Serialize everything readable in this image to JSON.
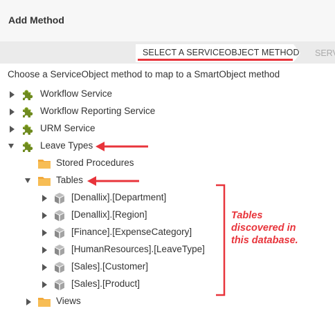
{
  "dialog": {
    "title": "Add Method"
  },
  "wizard": {
    "steps": [
      {
        "label": "SELECT A SERVICEOBJECT METHOD",
        "active": true
      },
      {
        "label": "SERV",
        "active": false
      }
    ],
    "accent_color": "#e8343b"
  },
  "instruction": "Choose a ServiceObject method to map to a SmartObject method",
  "tree": {
    "service_1": {
      "label": "Workflow Service",
      "icon": "puzzle-piece-icon",
      "expanded": false
    },
    "service_2": {
      "label": "Workflow Reporting Service",
      "icon": "puzzle-piece-icon",
      "expanded": false
    },
    "service_3": {
      "label": "URM Service",
      "icon": "puzzle-piece-icon",
      "expanded": false
    },
    "service_4": {
      "label": "Leave Types",
      "icon": "puzzle-piece-icon",
      "expanded": true
    },
    "folder_stored_procedures": {
      "label": "Stored Procedures",
      "icon": "folder-icon"
    },
    "folder_tables": {
      "label": "Tables",
      "icon": "folder-icon",
      "expanded": true
    },
    "tables": [
      {
        "label": "[Denallix].[Department]",
        "icon": "cube-icon"
      },
      {
        "label": "[Denallix].[Region]",
        "icon": "cube-icon"
      },
      {
        "label": "[Finance].[ExpenseCategory]",
        "icon": "cube-icon"
      },
      {
        "label": "[HumanResources].[LeaveType]",
        "icon": "cube-icon"
      },
      {
        "label": "[Sales].[Customer]",
        "icon": "cube-icon"
      },
      {
        "label": "[Sales].[Product]",
        "icon": "cube-icon"
      }
    ],
    "folder_views": {
      "label": "Views",
      "icon": "folder-icon",
      "expanded": false
    }
  },
  "annotation": {
    "text": "Tables\ndiscovered in\nthis database.",
    "color": "#e8343b"
  }
}
